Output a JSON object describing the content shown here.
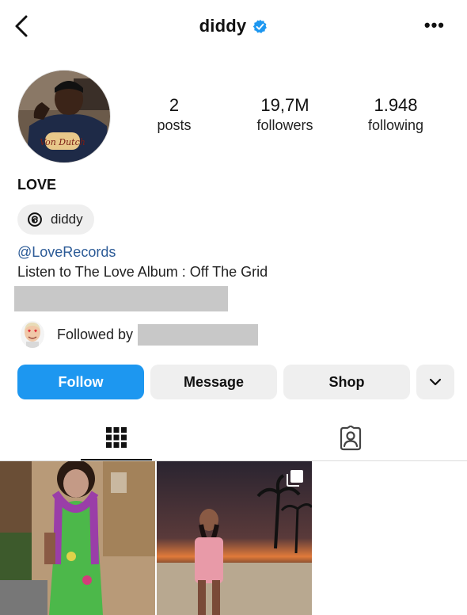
{
  "header": {
    "username": "diddy",
    "back_icon": "chevron-left-icon",
    "more_icon": "more-horizontal-icon",
    "verified_icon": "verified-badge-icon",
    "more_label": "•••"
  },
  "profile": {
    "avatar_icon": "profile-photo",
    "stats": [
      {
        "value": "2",
        "label": "posts"
      },
      {
        "value": "19,7M",
        "label": "followers"
      },
      {
        "value": "1.948",
        "label": "following"
      }
    ],
    "name": "LOVE",
    "threads_chip": {
      "icon": "threads-icon",
      "label": "diddy"
    },
    "link": "@LoveRecords",
    "bio": "Listen to The Love Album : Off The Grid",
    "followed_by_label": "Followed by"
  },
  "actions": {
    "follow": "Follow",
    "message": "Message",
    "shop": "Shop",
    "dropdown_icon": "chevron-down-icon"
  },
  "tabs": [
    {
      "name": "grid",
      "icon": "grid-icon",
      "active": true
    },
    {
      "name": "tagged",
      "icon": "tagged-user-icon",
      "active": false
    }
  ],
  "colors": {
    "accent": "#1d97f0",
    "link": "#2b5a96",
    "button_grey": "#efefef",
    "redaction": "#c8c8c8"
  }
}
